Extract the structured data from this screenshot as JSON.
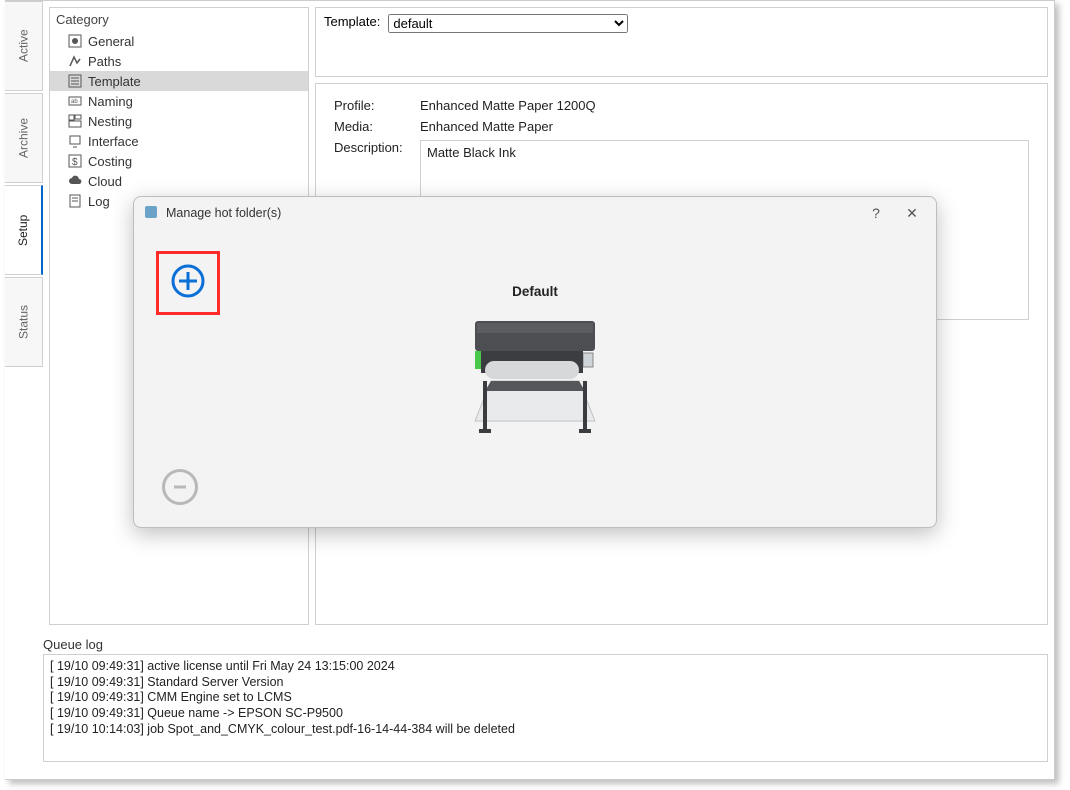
{
  "vtabs": [
    "Active",
    "Archive",
    "Setup",
    "Status"
  ],
  "vtab_selected": 2,
  "category": {
    "title": "Category",
    "items": [
      {
        "label": "General",
        "icon": "dot",
        "selected": false
      },
      {
        "label": "Paths",
        "icon": "paths",
        "selected": false
      },
      {
        "label": "Template",
        "icon": "template",
        "selected": true
      },
      {
        "label": "Naming",
        "icon": "naming",
        "selected": false
      },
      {
        "label": "Nesting",
        "icon": "nesting",
        "selected": false
      },
      {
        "label": "Interface",
        "icon": "interface",
        "selected": false
      },
      {
        "label": "Costing",
        "icon": "costing",
        "selected": false
      },
      {
        "label": "Cloud",
        "icon": "cloud",
        "selected": false
      },
      {
        "label": "Log",
        "icon": "log",
        "selected": false
      }
    ]
  },
  "template_header": {
    "label": "Template:",
    "selected": "default"
  },
  "details": {
    "profile_label": "Profile:",
    "profile_value": "Enhanced Matte Paper 1200Q",
    "media_label": "Media:",
    "media_value": "Enhanced Matte Paper",
    "desc_label": "Description:",
    "desc_value": "Matte Black Ink"
  },
  "dialog": {
    "title": "Manage hot folder(s)",
    "help": "?",
    "close": "✕",
    "device_label": "Default"
  },
  "queue": {
    "title": "Queue log",
    "lines": [
      "[ 19/10 09:49:31] active license until Fri May 24 13:15:00 2024",
      "[ 19/10 09:49:31] Standard Server Version",
      "[ 19/10 09:49:31] CMM Engine set to LCMS",
      "[ 19/10 09:49:31] Queue name -> EPSON SC-P9500",
      "[ 19/10 10:14:03] job Spot_and_CMYK_colour_test.pdf-16-14-44-384 will be deleted"
    ]
  }
}
